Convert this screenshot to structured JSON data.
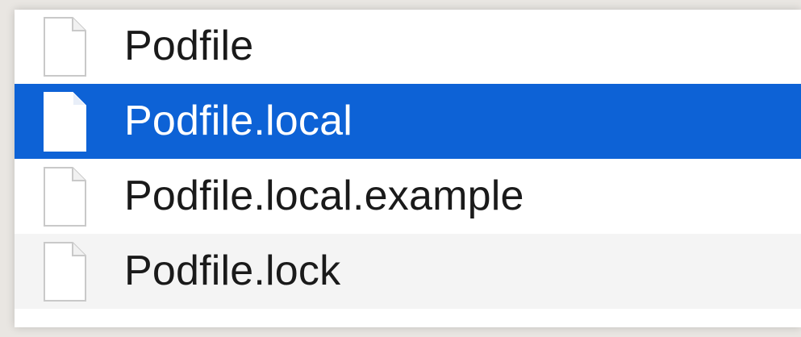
{
  "file_list": {
    "items": [
      {
        "name": "Podfile",
        "icon": "document-icon",
        "selected": false
      },
      {
        "name": "Podfile.local",
        "icon": "document-icon",
        "selected": true
      },
      {
        "name": "Podfile.local.example",
        "icon": "document-icon",
        "selected": false
      },
      {
        "name": "Podfile.lock",
        "icon": "document-icon",
        "selected": false
      }
    ]
  },
  "colors": {
    "selection": "#0d62d6",
    "alternate_row": "#f4f4f4",
    "text": "#1a1a1a",
    "selected_text": "#ffffff"
  }
}
